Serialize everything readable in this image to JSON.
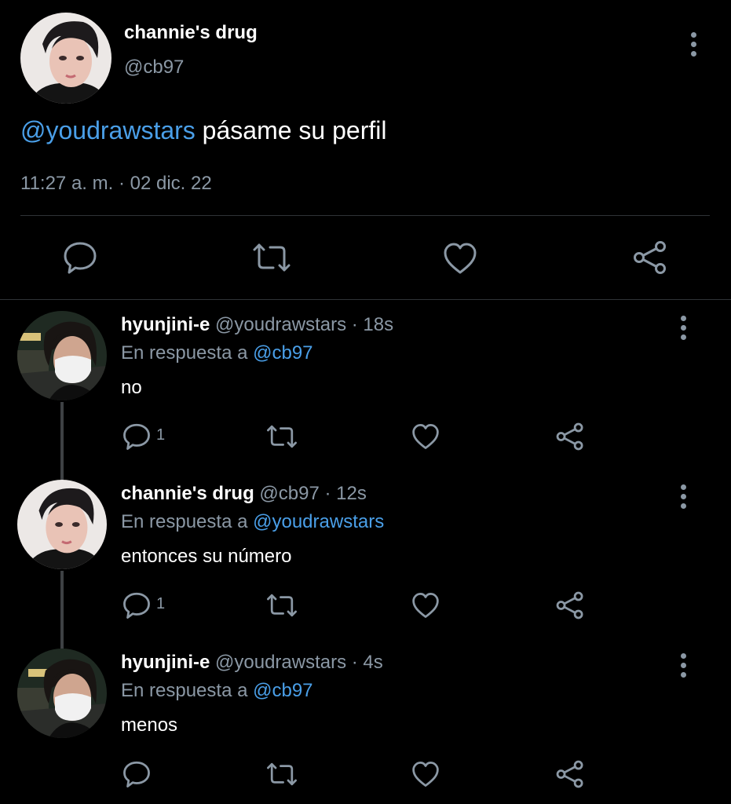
{
  "main_tweet": {
    "display_name": "channie's drug",
    "handle": "@cb97",
    "mention": "@youdrawstars",
    "text": " pásame su perfil",
    "timestamp": "11:27 a. m. · 02 dic. 22",
    "avatar_icon": "profile-photo",
    "actions": [
      "reply-icon",
      "retweet-icon",
      "like-icon",
      "share-icon"
    ]
  },
  "replies": [
    {
      "display_name": "hyunjini-e",
      "meta": " @youdrawstars · 18s",
      "reply_prefix": "En respuesta a ",
      "reply_to": "@cb97",
      "text": "no",
      "reply_count": "1"
    },
    {
      "display_name": "channie's drug",
      "meta": " @cb97 · 12s",
      "reply_prefix": "En respuesta a ",
      "reply_to": "@youdrawstars",
      "text": "entonces su número",
      "reply_count": "1"
    },
    {
      "display_name": "hyunjini-e",
      "meta": " @youdrawstars · 4s",
      "reply_prefix": "En respuesta a ",
      "reply_to": "@cb97",
      "text": "menos",
      "reply_count": ""
    }
  ],
  "colors": {
    "background": "#000000",
    "primary_text": "#ffffff",
    "secondary_text": "#8b98a5",
    "accent_link": "#4a9fe8",
    "divider": "#2f3336"
  }
}
